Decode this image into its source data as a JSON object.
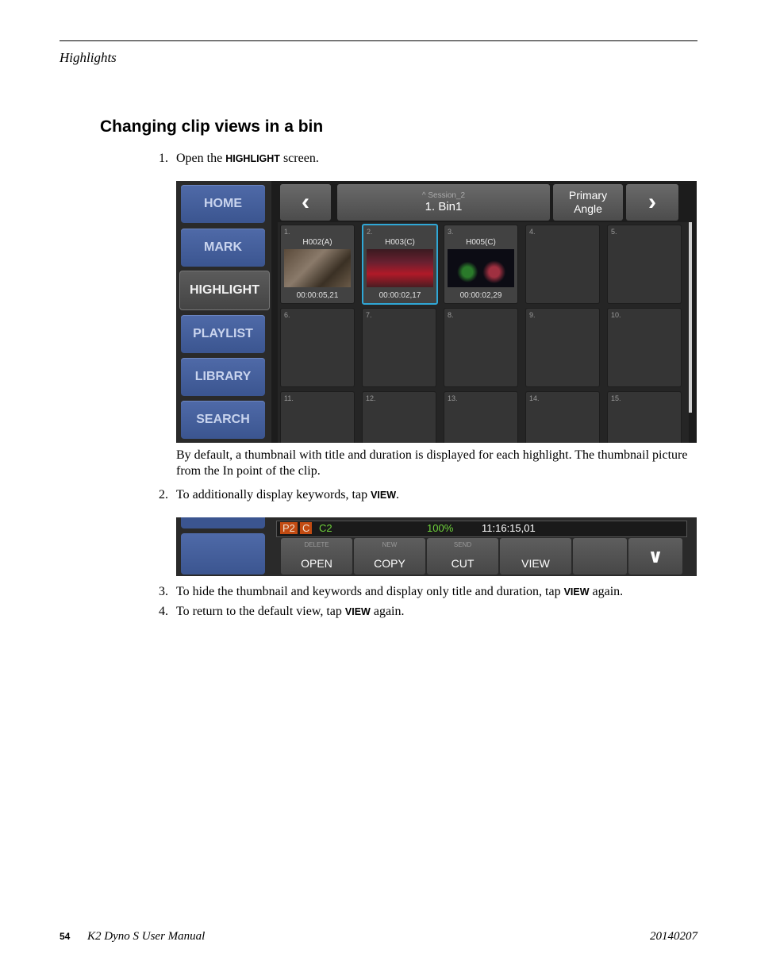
{
  "header": {
    "running_head": "Highlights"
  },
  "section_title": "Changing clip views in a bin",
  "steps": {
    "s1": {
      "num": "1.",
      "pre": "Open the",
      "kw": "HIGHLIGHT",
      "post": "screen."
    },
    "s2": {
      "num": "2.",
      "pre": "To additionally display keywords, tap",
      "kw": "VIEW",
      "post": "."
    },
    "s3": {
      "num": "3.",
      "pre": "To hide the thumbnail and keywords and display only title and duration, tap",
      "kw": "VIEW",
      "post": "again."
    },
    "s4": {
      "num": "4.",
      "pre": "To return to the default view, tap",
      "kw": "VIEW",
      "post": "again."
    }
  },
  "para1": "By default, a thumbnail with title and duration is displayed for each highlight. The thumbnail picture from the In point of the clip.",
  "screen1": {
    "nav": [
      "HOME",
      "MARK",
      "HIGHLIGHT",
      "PLAYLIST",
      "LIBRARY",
      "SEARCH"
    ],
    "session": "^ Session_2",
    "bin": "1. Bin1",
    "angle_line1": "Primary",
    "angle_line2": "Angle",
    "cells": [
      {
        "idx": "1.",
        "title": "H002(A)",
        "duration": "00:00:05,21"
      },
      {
        "idx": "2.",
        "title": "H003(C)",
        "duration": "00:00:02,17"
      },
      {
        "idx": "3.",
        "title": "H005(C)",
        "duration": "00:00:02,29"
      },
      {
        "idx": "4."
      },
      {
        "idx": "5."
      },
      {
        "idx": "6."
      },
      {
        "idx": "7."
      },
      {
        "idx": "8."
      },
      {
        "idx": "9."
      },
      {
        "idx": "10."
      },
      {
        "idx": "11."
      },
      {
        "idx": "12."
      },
      {
        "idx": "13."
      },
      {
        "idx": "14."
      },
      {
        "idx": "15."
      }
    ]
  },
  "screen2": {
    "status": {
      "p2": "P2",
      "c": "C",
      "c2": "C2",
      "percent": "100%",
      "timecode": "11:16:15,01"
    },
    "buttons": {
      "open": {
        "small": "DELETE",
        "main": "OPEN"
      },
      "copy": {
        "small": "NEW",
        "main": "COPY"
      },
      "cut": {
        "small": "SEND",
        "main": "CUT"
      },
      "view": {
        "small": "",
        "main": "VIEW"
      }
    }
  },
  "footer": {
    "page": "54",
    "title": "K2 Dyno S   User Manual",
    "date": "20140207"
  },
  "colors": {
    "nav_blue": "#4f6aa8",
    "select_border": "#2fa7d6",
    "percent_green": "#6fd33b",
    "badge_orange": "#c24b12"
  }
}
